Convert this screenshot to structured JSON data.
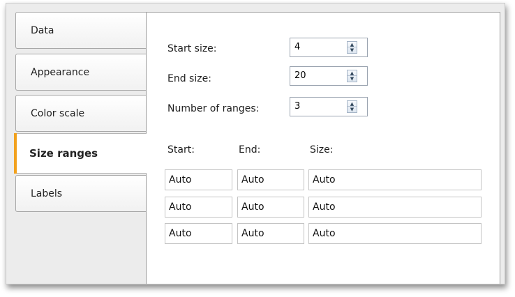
{
  "tabs": [
    {
      "label": "Data"
    },
    {
      "label": "Appearance"
    },
    {
      "label": "Color scale"
    },
    {
      "label": "Size ranges"
    },
    {
      "label": "Labels"
    }
  ],
  "active_tab": "Size ranges",
  "accent_color": "#f2a11d",
  "fields": {
    "start_size": {
      "label": "Start size:",
      "value": "4"
    },
    "end_size": {
      "label": "End size:",
      "value": "20"
    },
    "number_of_ranges": {
      "label": "Number of ranges:",
      "value": "3"
    }
  },
  "ranges_table": {
    "headers": {
      "start": "Start:",
      "end": "End:",
      "size": "Size:"
    },
    "rows": [
      {
        "start": "Auto",
        "end": "Auto",
        "size": "Auto"
      },
      {
        "start": "Auto",
        "end": "Auto",
        "size": "Auto"
      },
      {
        "start": "Auto",
        "end": "Auto",
        "size": "Auto"
      }
    ]
  },
  "icons": {
    "spin_up": "spin-up-arrow-icon",
    "spin_down": "spin-down-arrow-icon"
  }
}
